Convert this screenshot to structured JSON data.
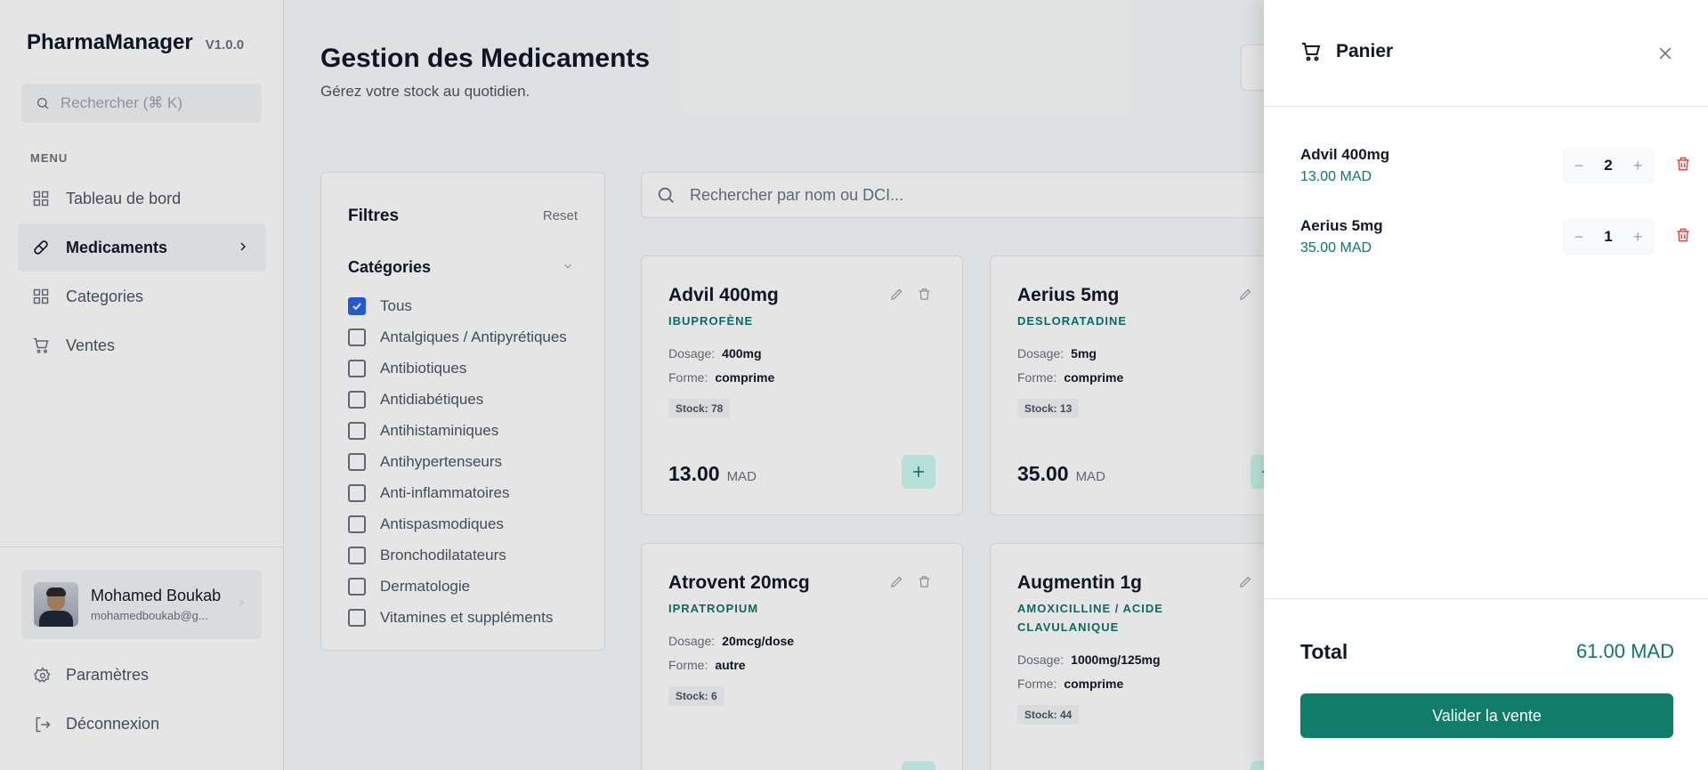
{
  "brand": {
    "name": "PharmaManager",
    "version": "V1.0.0"
  },
  "sidebar": {
    "search_placeholder": "Rechercher (⌘ K)",
    "menu_title": "MENU",
    "items": [
      {
        "label": "Tableau de bord",
        "icon": "grid-icon",
        "active": false
      },
      {
        "label": "Medicaments",
        "icon": "pill-icon",
        "active": true
      },
      {
        "label": "Categories",
        "icon": "grid-icon",
        "active": false
      },
      {
        "label": "Ventes",
        "icon": "cart-icon",
        "active": false
      }
    ],
    "user": {
      "name": "Mohamed Boukab",
      "email": "mohamedboukab@g..."
    },
    "settings_label": "Paramètres",
    "logout_label": "Déconnexion"
  },
  "header": {
    "title": "Gestion des Medicaments",
    "subtitle": "Gérez votre stock au quotidien."
  },
  "filters": {
    "title": "Filtres",
    "reset_label": "Reset",
    "categories_title": "Catégories",
    "categories": [
      {
        "label": "Tous",
        "checked": true
      },
      {
        "label": "Antalgiques / Antipyrétiques",
        "checked": false
      },
      {
        "label": "Antibiotiques",
        "checked": false
      },
      {
        "label": "Antidiabétiques",
        "checked": false
      },
      {
        "label": "Antihistaminiques",
        "checked": false
      },
      {
        "label": "Antihypertenseurs",
        "checked": false
      },
      {
        "label": "Anti-inflammatoires",
        "checked": false
      },
      {
        "label": "Antispasmodiques",
        "checked": false
      },
      {
        "label": "Bronchodilatateurs",
        "checked": false
      },
      {
        "label": "Dermatologie",
        "checked": false
      },
      {
        "label": "Vitamines et suppléments",
        "checked": false
      }
    ]
  },
  "search": {
    "placeholder": "Rechercher par nom ou DCI..."
  },
  "labels": {
    "dosage": "Dosage:",
    "forme": "Forme:",
    "currency": "MAD"
  },
  "medicines": [
    {
      "name": "Advil 400mg",
      "dci": "IBUPROFÈNE",
      "dosage": "400mg",
      "forme": "comprime",
      "stock": "Stock: 78",
      "price": "13.00"
    },
    {
      "name": "Aerius 5mg",
      "dci": "DESLORATADINE",
      "dosage": "5mg",
      "forme": "comprime",
      "stock": "Stock: 13",
      "price": "35.00"
    },
    {
      "name": "Atrovent 20mcg",
      "dci": "IPRATROPIUM",
      "dosage": "20mcg/dose",
      "forme": "autre",
      "stock": "Stock: 6",
      "price": ""
    },
    {
      "name": "Augmentin 1g",
      "dci": "AMOXICILLINE / ACIDE CLAVULANIQUE",
      "dosage": "1000mg/125mg",
      "forme": "comprime",
      "stock": "Stock: 44",
      "price": ""
    }
  ],
  "cart": {
    "title": "Panier",
    "items": [
      {
        "name": "Advil 400mg",
        "price": "13.00 MAD",
        "qty": "2"
      },
      {
        "name": "Aerius 5mg",
        "price": "35.00 MAD",
        "qty": "1"
      }
    ],
    "total_label": "Total",
    "total_value": "61.00 MAD",
    "validate_label": "Valider la vente"
  },
  "colors": {
    "accent": "#0f7d6a",
    "teal_text": "#0f766e",
    "checkbox": "#2563eb",
    "danger": "#ef4444"
  }
}
